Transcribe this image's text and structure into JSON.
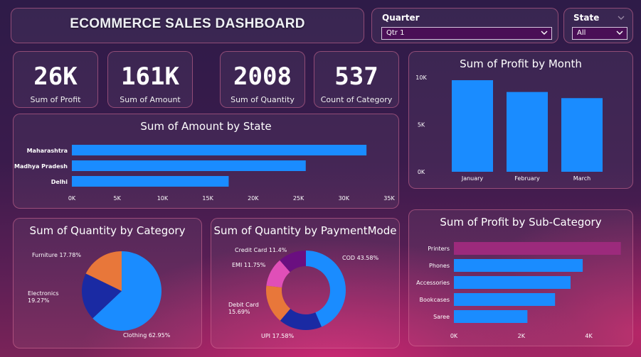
{
  "header": {
    "title": "ECOMMERCE SALES DASHBOARD"
  },
  "filters": {
    "quarter": {
      "label": "Quarter",
      "value": "Qtr 1"
    },
    "state": {
      "label": "State",
      "value": "All"
    }
  },
  "kpis": [
    {
      "value": "26K",
      "label": "Sum of Profit"
    },
    {
      "value": "161K",
      "label": "Sum of Amount"
    },
    {
      "value": "2008",
      "label": "Sum of Quantity"
    },
    {
      "value": "537",
      "label": "Count of Category"
    }
  ],
  "colors": {
    "bar": "#1a8cff",
    "highlight": "#9c2a7c",
    "orange": "#e8773a",
    "navy": "#1a2aa3",
    "pink": "#e04fb8",
    "purple": "#6a0f80"
  },
  "chart_data": [
    {
      "id": "amount_by_state",
      "type": "bar",
      "title": "Sum of Amount by State",
      "orientation": "horizontal",
      "categories": [
        "Maharashtra",
        "Madhya Pradesh",
        "Delhi"
      ],
      "values": [
        32500,
        25800,
        17300
      ],
      "ticks": [
        "0K",
        "5K",
        "10K",
        "15K",
        "20K",
        "25K",
        "30K",
        "35K"
      ],
      "xlim": [
        0,
        35000
      ]
    },
    {
      "id": "profit_by_month",
      "type": "bar",
      "title": "Sum of Profit by Month",
      "orientation": "vertical",
      "categories": [
        "January",
        "February",
        "March"
      ],
      "values": [
        9700,
        8450,
        7800
      ],
      "ticks": [
        "0K",
        "5K",
        "10K"
      ],
      "ylim": [
        0,
        10000
      ]
    },
    {
      "id": "quantity_by_category",
      "type": "pie",
      "title": "Sum of Quantity by Category",
      "slices": [
        {
          "name": "Clothing",
          "pct": 62.95,
          "label": "Clothing 62.95%"
        },
        {
          "name": "Electronics",
          "pct": 19.27,
          "label": "Electronics\n19.27%"
        },
        {
          "name": "Furniture",
          "pct": 17.78,
          "label": "Furniture 17.78%"
        }
      ]
    },
    {
      "id": "quantity_by_paymentmode",
      "type": "donut",
      "title": "Sum of Quantity by PaymentMode",
      "slices": [
        {
          "name": "COD",
          "pct": 43.58,
          "label": "COD 43.58%"
        },
        {
          "name": "UPI",
          "pct": 17.58,
          "label": "UPI 17.58%"
        },
        {
          "name": "Debit Card",
          "pct": 15.69,
          "label": "Debit Card\n15.69%"
        },
        {
          "name": "EMI",
          "pct": 11.75,
          "label": "EMI 11.75%"
        },
        {
          "name": "Credit Card",
          "pct": 11.4,
          "label": "Credit Card 11.4%"
        }
      ]
    },
    {
      "id": "profit_by_subcategory",
      "type": "bar",
      "title": "Sum of Profit by Sub-Category",
      "orientation": "horizontal",
      "categories": [
        "Printers",
        "Phones",
        "Accessories",
        "Bookcases",
        "Saree"
      ],
      "values": [
        4950,
        3820,
        3460,
        3000,
        2180
      ],
      "ticks": [
        "0K",
        "2K",
        "4K"
      ],
      "xlim": [
        0,
        5000
      ]
    }
  ]
}
